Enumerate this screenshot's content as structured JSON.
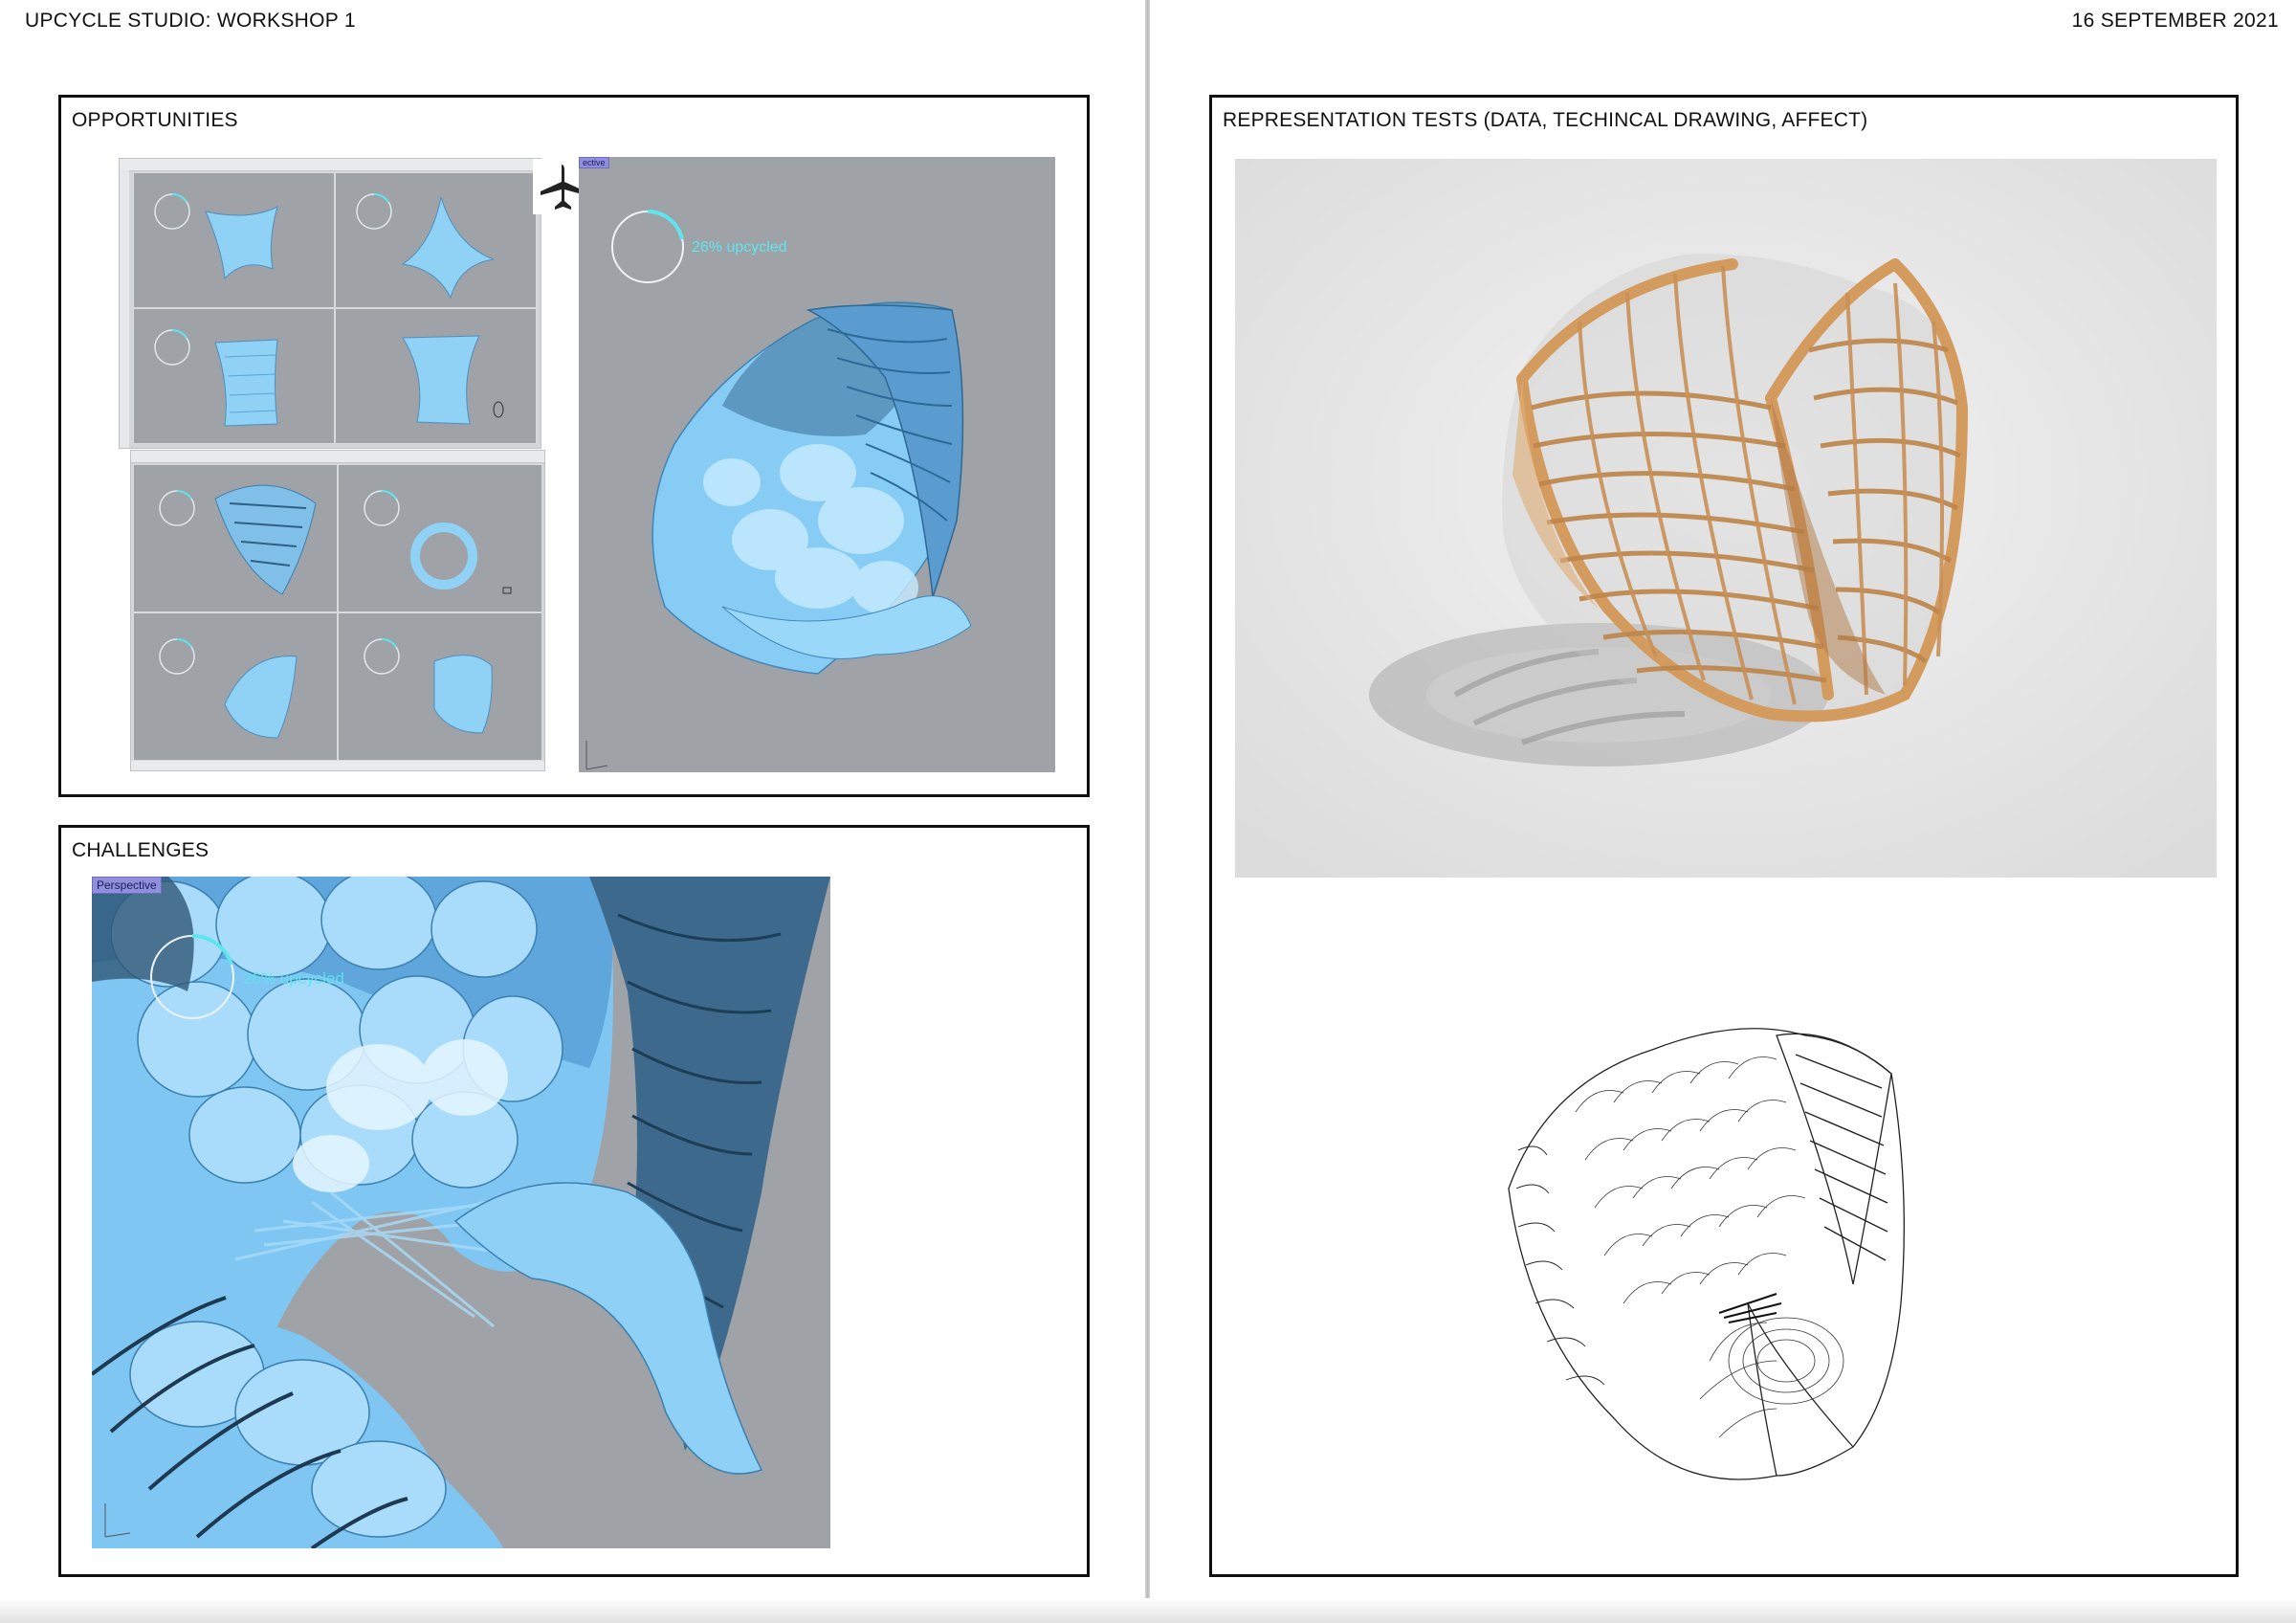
{
  "header": {
    "title": "UPCYCLE STUDIO: WORKSHOP 1",
    "date": "16 SEPTEMBER 2021"
  },
  "panels": {
    "opportunities": {
      "title": "OPPORTUNITIES",
      "viewport_tab": "ective",
      "upcycled_label": "26% upcycled",
      "upcycled_fraction": 0.26
    },
    "challenges": {
      "title": "CHALLENGES",
      "viewport_tab": "Perspective",
      "upcycled_label": "26% upcycled",
      "upcycled_fraction": 0.26
    },
    "representation": {
      "title": "REPRESENTATION TESTS (DATA, TECHINCAL DRAWING, AFFECT)"
    }
  },
  "icons": [
    "airplane-icon",
    "progress-ring-icon",
    "axis-gizmo-icon"
  ],
  "colors": {
    "viewport_grey": "#9fa3a8",
    "model_blue": "#7fc6f2",
    "progress_cyan": "#5ee6ee",
    "timber": "#d9a46a",
    "render_bg": "#e6e6e6"
  }
}
